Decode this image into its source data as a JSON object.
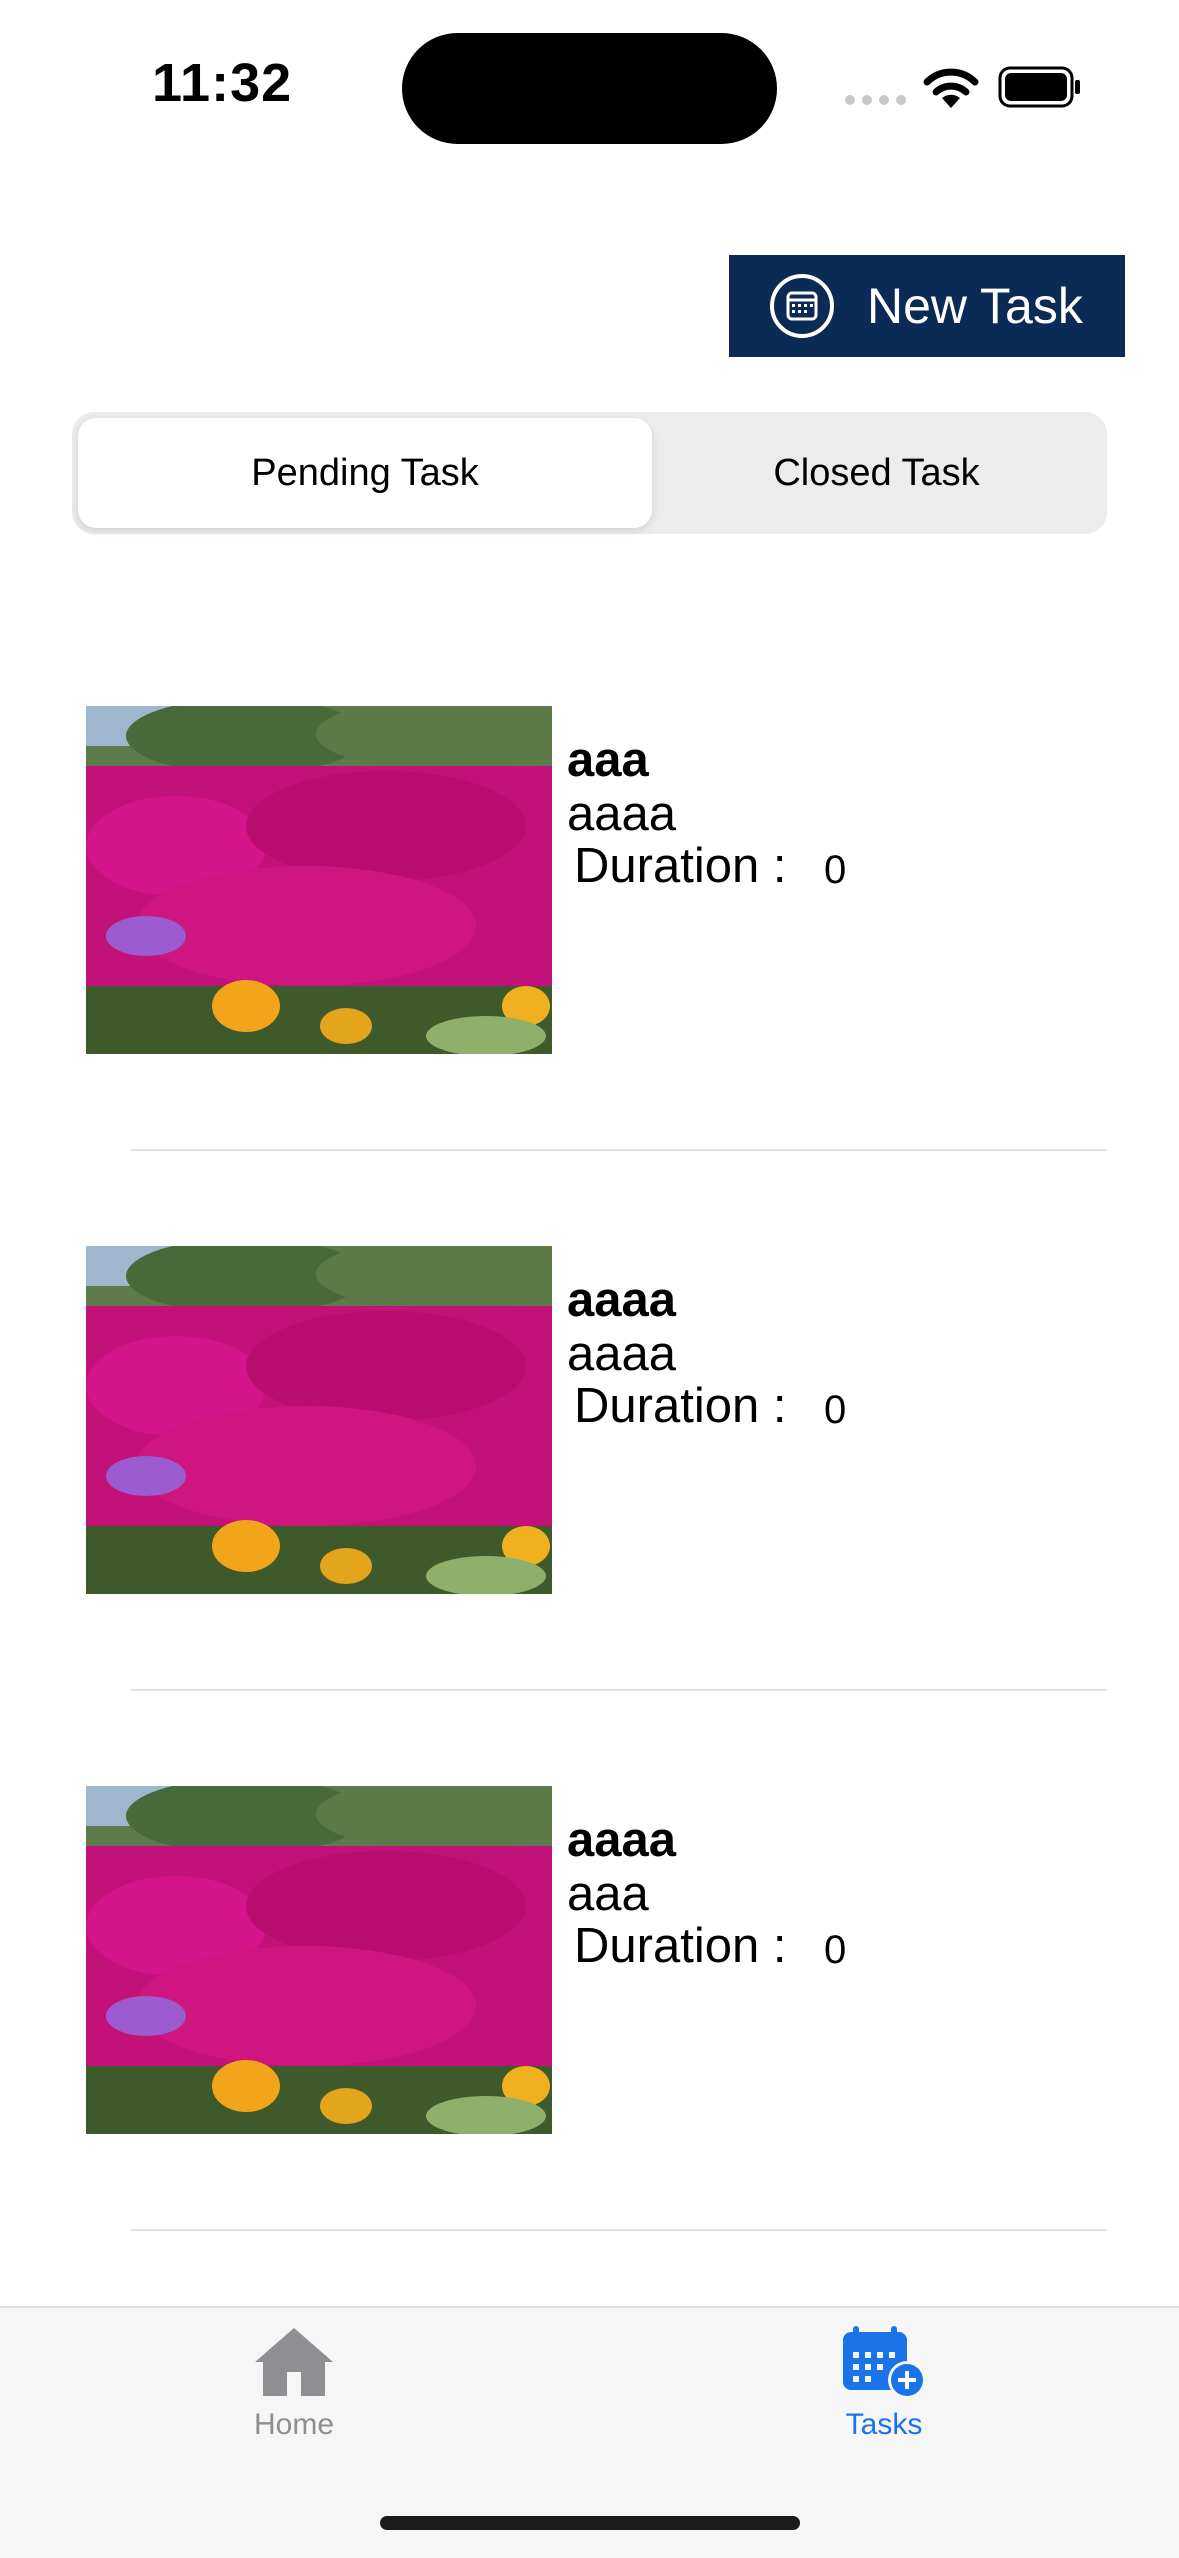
{
  "status_bar": {
    "time": "11:32"
  },
  "header": {
    "new_task_label": "New Task"
  },
  "segments": {
    "pending_label": "Pending Task",
    "closed_label": "Closed Task",
    "selected": "Pending Task"
  },
  "tasks": [
    {
      "title": "aaa",
      "description": "aaaa",
      "duration_label": "Duration :",
      "duration_value": "0"
    },
    {
      "title": "aaaa",
      "description": "aaaa",
      "duration_label": "Duration :",
      "duration_value": "0"
    },
    {
      "title": "aaaa",
      "description": "aaa",
      "duration_label": "Duration :",
      "duration_value": "0"
    }
  ],
  "tab_bar": {
    "home_label": "Home",
    "tasks_label": "Tasks",
    "active": "Tasks"
  },
  "colors": {
    "brand": "#0b2a55",
    "accent": "#1a73e8",
    "inactive": "#8e8e93"
  }
}
